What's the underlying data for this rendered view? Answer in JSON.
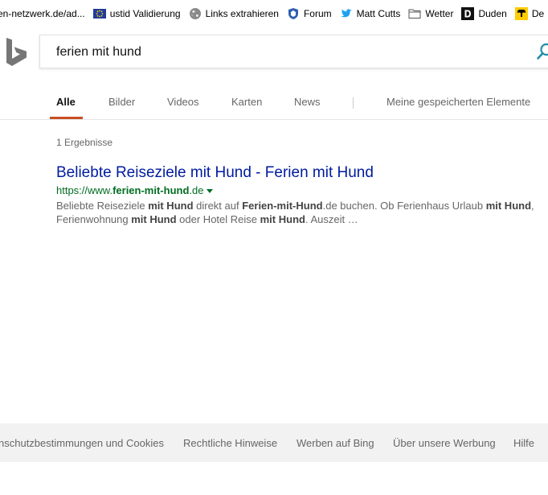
{
  "bookmarks": [
    {
      "label": "en-netzwerk.de/ad...",
      "icon": "none"
    },
    {
      "label": "ustid Validierung",
      "icon": "eu-flag-icon"
    },
    {
      "label": "Links extrahieren",
      "icon": "globe-icon"
    },
    {
      "label": "Forum",
      "icon": "shield-icon"
    },
    {
      "label": "Matt Cutts",
      "icon": "twitter-bird-icon"
    },
    {
      "label": "Wetter",
      "icon": "folder-icon"
    },
    {
      "label": "Duden",
      "icon": "duden-d-icon"
    },
    {
      "label": "De",
      "icon": "post-horn-icon"
    }
  ],
  "search": {
    "value": "ferien mit hund"
  },
  "tabs": [
    {
      "label": "Alle",
      "active": true
    },
    {
      "label": "Bilder",
      "active": false
    },
    {
      "label": "Videos",
      "active": false
    },
    {
      "label": "Karten",
      "active": false
    },
    {
      "label": "News",
      "active": false
    }
  ],
  "saved_items_label": "Meine gespeicherten Elemente",
  "results": {
    "count_label": "1 Ergebnisse",
    "items": [
      {
        "title": "Beliebte Reiseziele mit Hund - Ferien mit Hund",
        "url_prefix": "https://www.",
        "url_bold": "ferien-mit-hund",
        "url_suffix": ".de",
        "snippet": [
          {
            "t": "Beliebte Reiseziele ",
            "b": false
          },
          {
            "t": "mit Hund",
            "b": true
          },
          {
            "t": " direkt auf ",
            "b": false
          },
          {
            "t": "Ferien-mit-Hund",
            "b": true
          },
          {
            "t": ".de buchen. Ob Ferienhaus Urlaub ",
            "b": false
          },
          {
            "t": "mit Hund",
            "b": true
          },
          {
            "t": ", Ferienwohnung ",
            "b": false
          },
          {
            "t": "mit Hund",
            "b": true
          },
          {
            "t": " oder Hotel Reise ",
            "b": false
          },
          {
            "t": "mit Hund",
            "b": true
          },
          {
            "t": ". Auszeit …",
            "b": false
          }
        ]
      }
    ]
  },
  "footer": {
    "links": [
      "nschutzbestimmungen und Cookies",
      "Rechtliche Hinweise",
      "Werben auf Bing",
      "Über unsere Werbung",
      "Hilfe"
    ]
  },
  "colors": {
    "accent_tab": "#c94e24",
    "link_title": "#001ba0",
    "url_green": "#006d21",
    "bing_logo": "#767676"
  }
}
